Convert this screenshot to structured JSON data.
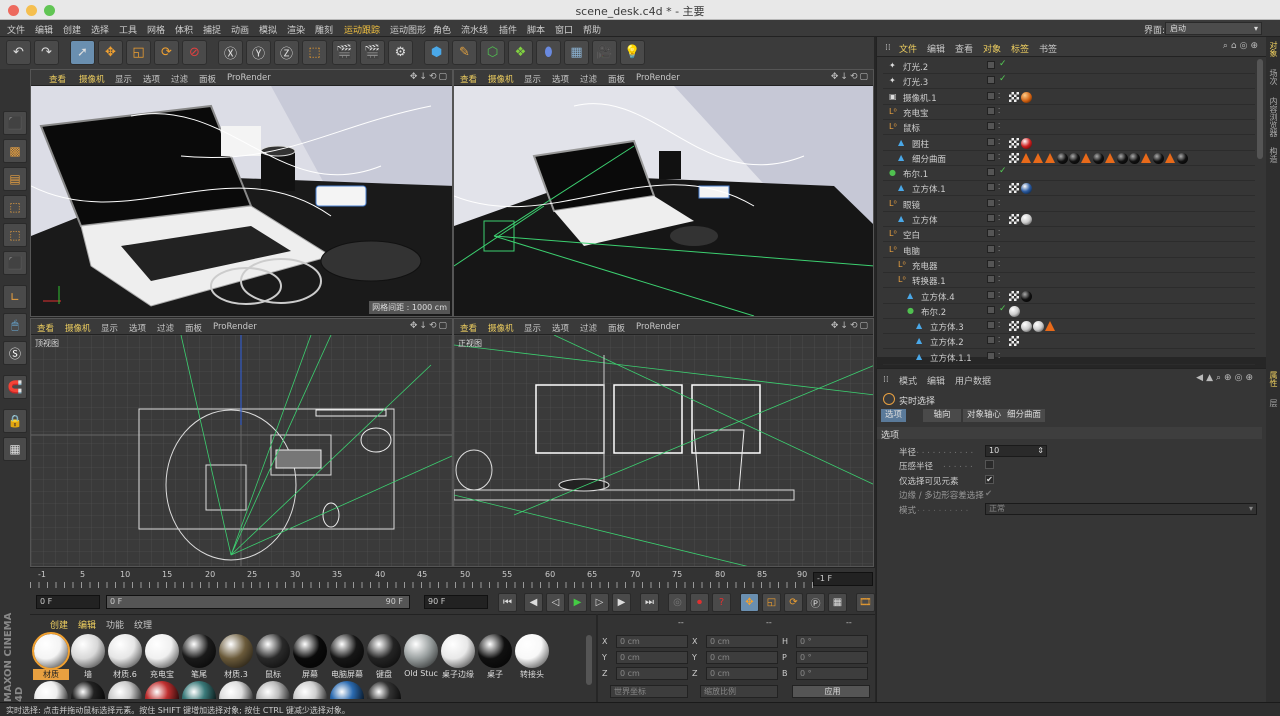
{
  "window": {
    "title": "scene_desk.c4d * - 主要"
  },
  "menubar": {
    "items": [
      "文件",
      "编辑",
      "创建",
      "选择",
      "工具",
      "网格",
      "体积",
      "捕捉",
      "动画",
      "模拟",
      "渲染",
      "雕刻",
      "运动跟踪",
      "运动图形",
      "角色",
      "流水线",
      "插件",
      "脚本",
      "窗口",
      "帮助"
    ],
    "layout_label": "界面:",
    "layout_value": "启动"
  },
  "viewport_menu": [
    "查看",
    "摄像机",
    "显示",
    "选项",
    "过滤",
    "面板",
    "ProRender"
  ],
  "viewports": [
    {
      "name": "",
      "grid_label": "网格间距 : 1000 cm"
    },
    {
      "name": ""
    },
    {
      "name": "顶视图"
    },
    {
      "name": "正视图"
    }
  ],
  "timeline": {
    "ticks": [
      "-1",
      "5",
      "10",
      "15",
      "20",
      "25",
      "30",
      "35",
      "40",
      "45",
      "50",
      "55",
      "60",
      "65",
      "70",
      "75",
      "80",
      "85",
      "90"
    ],
    "current_frame": "-1 F",
    "start": "0 F",
    "range_start": "0 F",
    "range_end": "90 F",
    "end": "90 F"
  },
  "materials": {
    "menu": [
      "创建",
      "编辑",
      "功能",
      "纹理"
    ],
    "items": [
      {
        "label": "材质",
        "color": "#f4f4f4",
        "selected": true
      },
      {
        "label": "墙",
        "color": "#d8d8d8"
      },
      {
        "label": "材质.6",
        "color": "#e6e6e6"
      },
      {
        "label": "充电宝",
        "color": "#f0f0f0"
      },
      {
        "label": "笔尾",
        "color": "#1a1a1a"
      },
      {
        "label": "材质.3",
        "color": "#6a5a3a"
      },
      {
        "label": "鼠标",
        "color": "#2a2a2a"
      },
      {
        "label": "屏幕",
        "color": "#0a0a0a"
      },
      {
        "label": "电脑屏幕",
        "color": "#161616"
      },
      {
        "label": "键盘",
        "color": "#242424"
      },
      {
        "label": "Old Stuc",
        "color": "#9aa0a0"
      },
      {
        "label": "桌子边缘",
        "color": "#e8e8e8"
      },
      {
        "label": "桌子",
        "color": "#101010"
      },
      {
        "label": "转接头",
        "color": "#f8f8f8"
      }
    ],
    "row2_colors": [
      "#eeeeee",
      "#222222",
      "#cccccc",
      "#c03030",
      "#3a7a7a",
      "#dddddd",
      "#bbbbbb",
      "#cfcfcf",
      "#2a6ab0",
      "#333333"
    ]
  },
  "coordinates": {
    "headers": [
      "--",
      "--",
      "--"
    ],
    "rows": [
      {
        "a_label": "X",
        "a": "0 cm",
        "b_label": "X",
        "b": "0 cm",
        "c_label": "H",
        "c": "0 °"
      },
      {
        "a_label": "Y",
        "a": "0 cm",
        "b_label": "Y",
        "b": "0 cm",
        "c_label": "P",
        "c": "0 °"
      },
      {
        "a_label": "Z",
        "a": "0 cm",
        "b_label": "Z",
        "b": "0 cm",
        "c_label": "B",
        "c": "0 °"
      }
    ],
    "mode_world": "世界坐标",
    "mode_scale": "缩放比例",
    "apply": "应用"
  },
  "object_manager": {
    "menu": [
      "文件",
      "编辑",
      "查看",
      "对象",
      "标签",
      "书签"
    ],
    "rows": [
      {
        "name": "灯光.2",
        "indent": 0,
        "icon": "light",
        "check": true,
        "tags": []
      },
      {
        "name": "灯光.3",
        "indent": 0,
        "icon": "light",
        "check": true,
        "tags": []
      },
      {
        "name": "摄像机.1",
        "indent": 0,
        "icon": "camera",
        "check": false,
        "tags": [
          "chk",
          "orange"
        ]
      },
      {
        "name": "充电宝",
        "indent": 0,
        "icon": "null",
        "check": false,
        "tags": []
      },
      {
        "name": "鼠标",
        "indent": 0,
        "icon": "null",
        "check": false,
        "tags": []
      },
      {
        "name": "圆柱",
        "indent": 1,
        "icon": "cyl",
        "check": false,
        "tags": [
          "chk",
          "red"
        ]
      },
      {
        "name": "细分曲面",
        "indent": 1,
        "icon": "sub",
        "check": false,
        "tags": [
          "chk",
          "tri",
          "tri",
          "tri",
          "black",
          "black",
          "tri",
          "black",
          "tri",
          "black",
          "black",
          "tri",
          "black",
          "tri",
          "black"
        ]
      },
      {
        "name": "布尔.1",
        "indent": 0,
        "icon": "bool",
        "check": true,
        "tags": []
      },
      {
        "name": "立方体.1",
        "indent": 1,
        "icon": "cube",
        "check": false,
        "tags": [
          "chk",
          "blue"
        ]
      },
      {
        "name": "眼镜",
        "indent": 0,
        "icon": "null",
        "check": false,
        "tags": []
      },
      {
        "name": "立方体",
        "indent": 1,
        "icon": "cube",
        "check": false,
        "tags": [
          "chk",
          "white"
        ]
      },
      {
        "name": "空白",
        "indent": 0,
        "icon": "null",
        "check": false,
        "tags": []
      },
      {
        "name": "电脑",
        "indent": 0,
        "icon": "null",
        "check": false,
        "tags": []
      },
      {
        "name": "充电器",
        "indent": 1,
        "icon": "null",
        "check": false,
        "tags": []
      },
      {
        "name": "转换器.1",
        "indent": 1,
        "icon": "null",
        "check": false,
        "tags": []
      },
      {
        "name": "立方体.4",
        "indent": 2,
        "icon": "cube",
        "check": false,
        "tags": [
          "chk",
          "black"
        ]
      },
      {
        "name": "布尔.2",
        "indent": 2,
        "icon": "bool",
        "check": true,
        "tags": [
          "white"
        ]
      },
      {
        "name": "立方体.3",
        "indent": 3,
        "icon": "cube",
        "check": false,
        "tags": [
          "chk",
          "white",
          "white",
          "tri"
        ]
      },
      {
        "name": "立方体.2",
        "indent": 3,
        "icon": "cube",
        "check": false,
        "tags": [
          "chk"
        ]
      },
      {
        "name": "立方体.1.1",
        "indent": 3,
        "icon": "cube",
        "check": false,
        "tags": []
      }
    ]
  },
  "attributes": {
    "menu": [
      "模式",
      "编辑",
      "用户数据"
    ],
    "tool_name": "实时选择",
    "tabs": [
      "选项",
      "轴向",
      "对象轴心",
      "细分曲面"
    ],
    "section": "选项",
    "radius_label": "半径",
    "radius_value": "10",
    "pressure_label": "压感半径",
    "visible_only_label": "仅选择可见元素",
    "edge_poly_label": "边缘 / 多边形容差选择",
    "mode_label": "模式",
    "mode_value": "正常"
  },
  "right_strip": [
    "对象",
    "场次",
    "内容浏览器",
    "构造"
  ],
  "right_strip_bottom": [
    "属性",
    "层"
  ],
  "statusbar": "实时选择: 点击并拖动鼠标选择元素。按住 SHIFT 键增加选择对象; 按住 CTRL 键减少选择对象。",
  "brand": "MAXON CINEMA 4D"
}
